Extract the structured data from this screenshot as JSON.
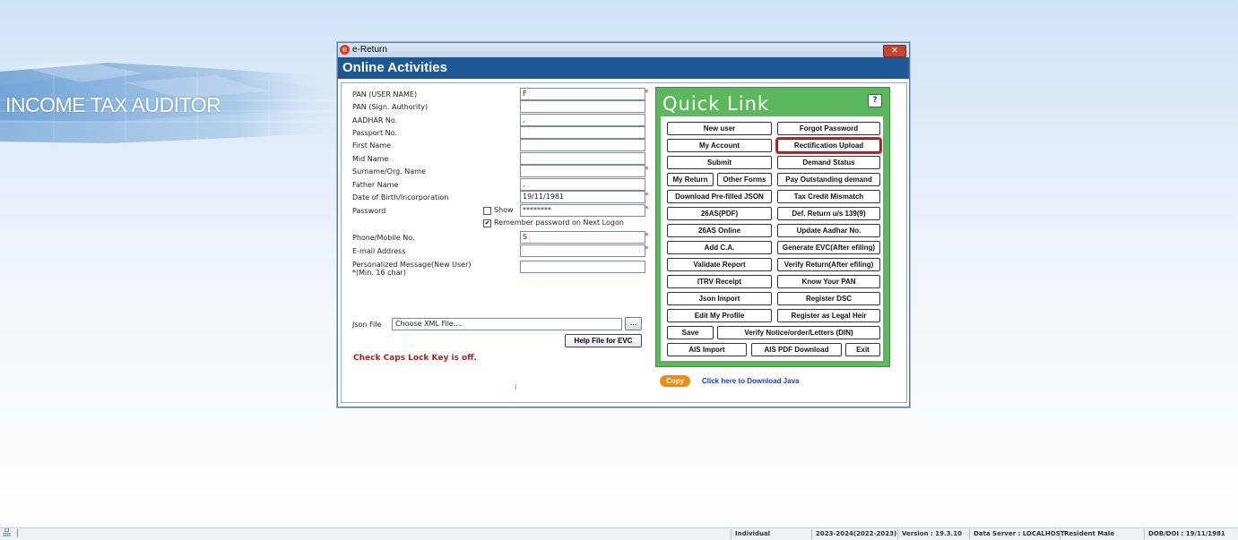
{
  "banner": {
    "title": "INCOME TAX AUDITOR"
  },
  "window": {
    "title": "e-Return",
    "app_icon": "e-logo-icon",
    "close_glyph": "✕",
    "header": "Online Activities"
  },
  "form": {
    "labels": {
      "pan_user": "PAN (USER NAME)",
      "pan_sign": "PAN (Sign. Authority)",
      "aadhar": "AADHAR No.",
      "passport": "Passport No.",
      "first_name": "First Name",
      "mid_name": "Mid Name",
      "surname": "Surname/Org. Name",
      "father": "Father Name",
      "dob": "Date of Birth/Incorporation",
      "password": "Password",
      "phone": "Phone/Mobile No.",
      "email": "E-mail Address",
      "message_line1": "Personalized Message(New User)",
      "message_line2": "*(Min. 16 char)",
      "json_file": "Json File"
    },
    "values": {
      "pan_user": "F",
      "pan_sign": "",
      "aadhar": ",",
      "passport": "",
      "first_name": "",
      "mid_name": "",
      "surname": "",
      "father": ",",
      "dob": "19/11/1981",
      "password": "********",
      "phone": "S",
      "email": "",
      "message": ""
    },
    "show_label": "Show",
    "show_checked": false,
    "remember_label": "Remember password on Next Logon",
    "remember_checked": true,
    "remember_glyph": "✔",
    "json_placeholder": "Choose XML File....",
    "browse_label": "...",
    "help_evc_label": "Help File for EVC",
    "caps_warning": "Check Caps Lock Key is off.",
    "required_mark": "*",
    "stray_mark": "i"
  },
  "quick_link": {
    "title": "Quick Link",
    "help_glyph": "?",
    "buttons": {
      "new_user": "New user",
      "forgot_password": "Forgot Password",
      "my_account": "My Account",
      "rectification_upload": "Rectification Upload",
      "submit": "Submit",
      "demand_status": "Demand Status",
      "my_return": "My Return",
      "other_forms": "Other Forms",
      "pay_outstanding": "Pay Outstanding demand",
      "download_prefilled": "Download Pre-filled JSON",
      "tax_credit_mismatch": "Tax Credit Mismatch",
      "26as_pdf": "26AS(PDF)",
      "def_return": "Def. Return u/s 139(9)",
      "26as_online": "26AS Online",
      "update_aadhar": "Update Aadhar No.",
      "add_ca": "Add C.A.",
      "generate_evc": "Generate EVC(After efiling)",
      "validate_report": "Validate Report",
      "verify_return": "Verify Return(After efiling)",
      "itrv_receipt": "ITRV Receipt",
      "know_your_pan": "Know Your PAN",
      "json_import": "Json Import",
      "register_dsc": "Register DSC",
      "edit_profile": "Edit My Profile",
      "register_legal_heir": "Register as Legal Heir",
      "save": "Save",
      "verify_notice": "Verify Notice/order/Letters (DIN)",
      "ais_import": "AIS Import",
      "ais_pdf_download": "AIS PDF Download",
      "exit": "Exit"
    }
  },
  "footer": {
    "copy_label": "Copy",
    "java_link": "Click here to Download Java"
  },
  "statusbar": {
    "icon": "network-icon",
    "icon_glyph": "品",
    "separator": "|",
    "taxpayer_type": "Individual",
    "assessment_year": "2023-2024(2022-2023)",
    "version": "Version : 19.3.10",
    "data_server": "Data Server : LOCALHOST",
    "residency": "Resident Male",
    "dob": "DOB/DOI : 19/11/1981"
  },
  "colors": {
    "header_bg": "#1b5894",
    "quick_link_bg": "#5cb85c",
    "required": "#e02020",
    "warning": "#c01818",
    "copy_bg": "#f18a12",
    "link": "#1b3fb5"
  }
}
